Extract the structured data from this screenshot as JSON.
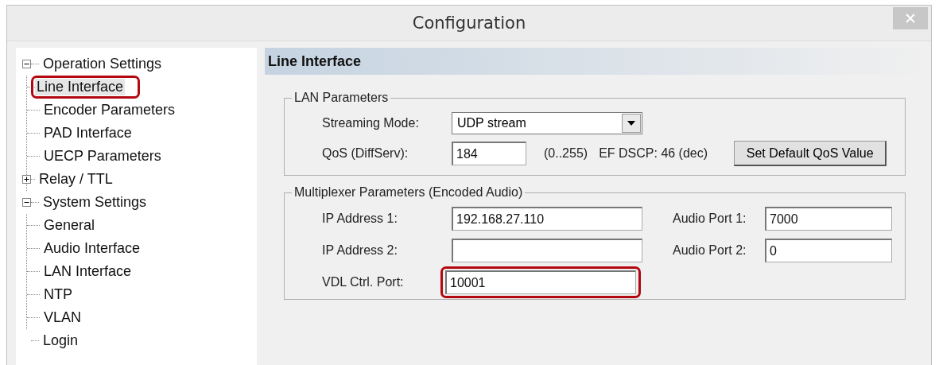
{
  "window": {
    "title": "Configuration"
  },
  "tree": [
    {
      "label": "Operation Settings",
      "expanded": true,
      "selected": false,
      "children": [
        {
          "label": "Line Interface",
          "selected": true,
          "highlighted": true
        },
        {
          "label": "Encoder Parameters",
          "selected": false
        },
        {
          "label": "PAD Interface",
          "selected": false
        },
        {
          "label": "UECP Parameters",
          "selected": false
        },
        {
          "label": "Relay / TTL",
          "selected": false,
          "expanded": false
        }
      ]
    },
    {
      "label": "System Settings",
      "expanded": true,
      "selected": false,
      "children": [
        {
          "label": "General",
          "selected": false
        },
        {
          "label": "Audio Interface",
          "selected": false
        },
        {
          "label": "LAN Interface",
          "selected": false
        },
        {
          "label": "NTP",
          "selected": false
        },
        {
          "label": "VLAN",
          "selected": false
        }
      ]
    },
    {
      "label": "Login",
      "selected": false
    }
  ],
  "panel": {
    "title": "Line Interface",
    "lan_parameters": {
      "title": "LAN Parameters",
      "streaming_mode": {
        "label": "Streaming Mode:",
        "value": "UDP stream"
      },
      "qos": {
        "label": "QoS (DiffServ):",
        "value": "184",
        "range": "(0..255)",
        "note": "EF DSCP: 46 (dec)",
        "button": "Set Default QoS Value"
      }
    },
    "multiplexer": {
      "title": "Multiplexer Parameters (Encoded Audio)",
      "fields": [
        {
          "label": "IP Address 1:",
          "value": "192.168.27.110",
          "highlighted": false
        },
        {
          "label": "IP Address 2:",
          "highlighted": false
        },
        {
          "label": "VDL Ctrl. Port:",
          "value": "10001",
          "highlighted": true
        }
      ],
      "ports": [
        {
          "label": "Audio Port 1:",
          "value": "7000"
        },
        {
          "label": "Audio Port 2:",
          "value": "0"
        }
      ]
    }
  }
}
